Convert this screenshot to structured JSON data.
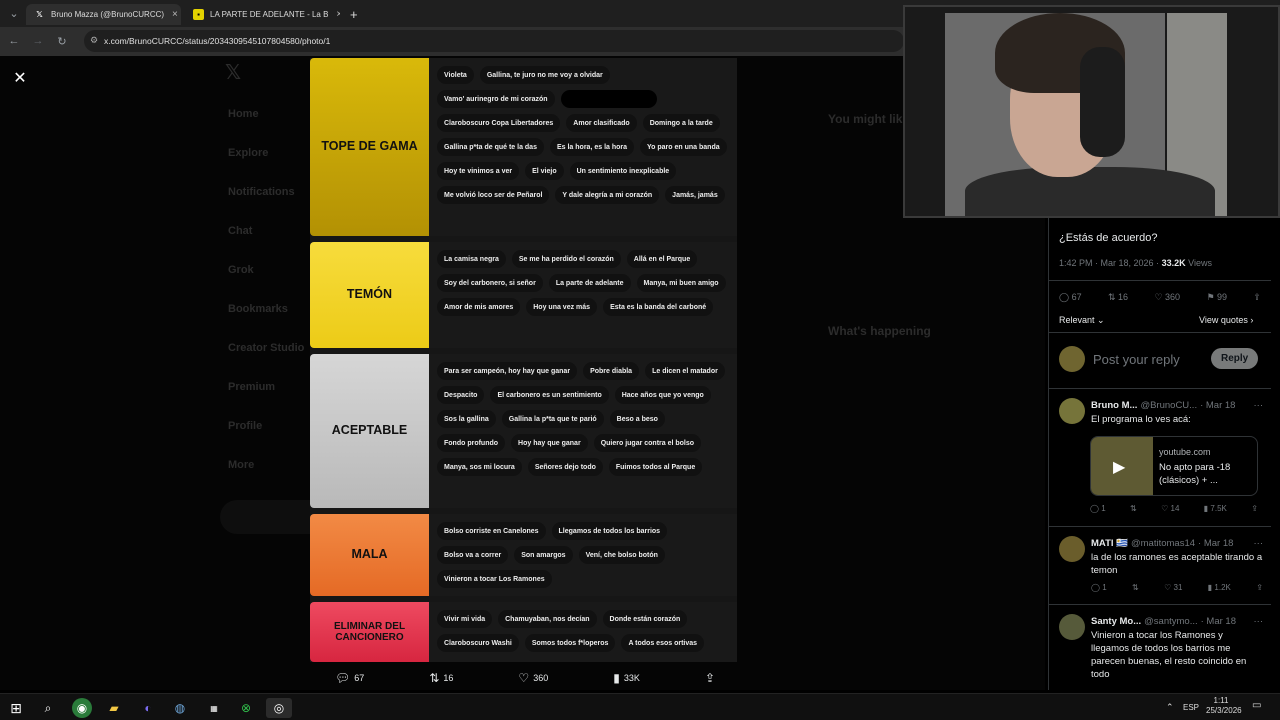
{
  "browser": {
    "tabs": [
      {
        "title": "Bruno Mazza (@BrunoCURCC)",
        "favicon": "x-logo"
      },
      {
        "title": "LA PARTE DE ADELANTE - La B",
        "favicon": "yellow-app"
      }
    ],
    "url": "x.com/BrunoCURCC/status/2034309545107804580/photo/1",
    "close_tab": "×",
    "new_tab": "+"
  },
  "background_nav": [
    "Home",
    "Explore",
    "Notifications",
    "Chat",
    "Grok",
    "Bookmarks",
    "Creator Studio",
    "Premium",
    "Profile",
    "More"
  ],
  "background_right": {
    "you_might": "You might like",
    "whats_happening": "What's happening"
  },
  "tiers": [
    {
      "label": "TOPE DE GAMA",
      "color": "#c9a806",
      "items": [
        "Violeta",
        "Gallina, te juro no me voy a olvidar",
        "Vamo' aurinegro de mi corazón",
        "",
        "Claroboscuro Copa Libertadores",
        "Amor clasificado",
        "Domingo a la tarde",
        "Gallina p*ta de qué te la das",
        "Es la hora, es la hora",
        "Yo paro en una banda",
        "Hoy te vinimos a ver",
        "El viejo",
        "Un sentimiento inexplicable",
        "Me volvió loco ser de Peñarol",
        "Y dale alegría a mi corazón",
        "Jamás, jamás"
      ]
    },
    {
      "label": "TEMÓN",
      "color": "#f2d227",
      "items": [
        "La camisa negra",
        "Se me ha perdido el corazón",
        "Allá en el Parque",
        "Soy del carbonero, si señor",
        "La parte de adelante",
        "Manya, mi buen amigo",
        "Amor de mis amores",
        "Hoy una vez más",
        "Esta es la banda del carboné"
      ]
    },
    {
      "label": "ACEPTABLE",
      "color": "#c9c9c9",
      "items": [
        "Para ser campeón, hoy hay que ganar",
        "Pobre diabla",
        "Le dicen el matador",
        "Despacito",
        "El carbonero es un sentimiento",
        "Hace años que yo vengo",
        "Sos la gallina",
        "Gallina la p*ta que te parió",
        "Beso a beso",
        "Fondo profundo",
        "Hoy hay que ganar",
        "Quiero jugar contra el bolso",
        "Manya, sos mi locura",
        "Señores dejo todo",
        "Fuimos todos al Parque"
      ]
    },
    {
      "label": "MALA",
      "color": "#ee7a33",
      "items": [
        "Bolso corriste en Canelones",
        "Llegamos de todos los barrios",
        "Bolso va a correr",
        "Son amargos",
        "Vení, che bolso botón",
        "Vinieron a tocar Los Ramones"
      ]
    },
    {
      "label": "ELIMINAR DEL CANCIONERO",
      "color": "#e5354f",
      "items": [
        "Vivir mi vida",
        "Chamuyaban, nos decían",
        "Donde están corazón",
        "Claroboscuro Washi",
        "Somos todos f*loperos",
        "A todos esos ortivas"
      ]
    }
  ],
  "image_actions": {
    "replies": "67",
    "reposts": "16",
    "likes": "360",
    "views": "33K"
  },
  "post": {
    "text": "¿Estás de acuerdo?",
    "time": "1:42 PM · Mar 18, 2026 ·",
    "views_count": "33.2K",
    "views_label": "Views",
    "replies": "67",
    "reposts": "16",
    "likes": "360",
    "bookmarks": "99",
    "sort": "Relevant",
    "view_quotes": "View quotes",
    "reply_placeholder": "Post your reply",
    "reply_button": "Reply"
  },
  "comments": [
    {
      "name": "Bruno M...",
      "handle": "@BrunoCU...",
      "date": "· Mar 18",
      "text": "El programa lo ves acá:",
      "card": {
        "domain": "youtube.com",
        "title": "No apto para -18 (clásicos) + ..."
      },
      "replies": "1",
      "reposts": "",
      "likes": "14",
      "views": "7.5K"
    },
    {
      "name": "MATI 🇺🇾",
      "handle": "@matitomas14",
      "date": "· Mar 18",
      "text": "la de los ramones es aceptable tirando a temon",
      "replies": "1",
      "reposts": "",
      "likes": "31",
      "views": "1.2K"
    },
    {
      "name": "Santy Mo...",
      "handle": "@santymo...",
      "date": "· Mar 18",
      "text": "Vinieron a tocar los Ramones y llegamos de todos los barrios me parecen buenas, el resto coincido en todo",
      "replies": "",
      "reposts": "",
      "likes": "",
      "views": ""
    }
  ],
  "taskbar": {
    "lang": "ESP",
    "time": "1:11",
    "date": "25/3/2026"
  }
}
